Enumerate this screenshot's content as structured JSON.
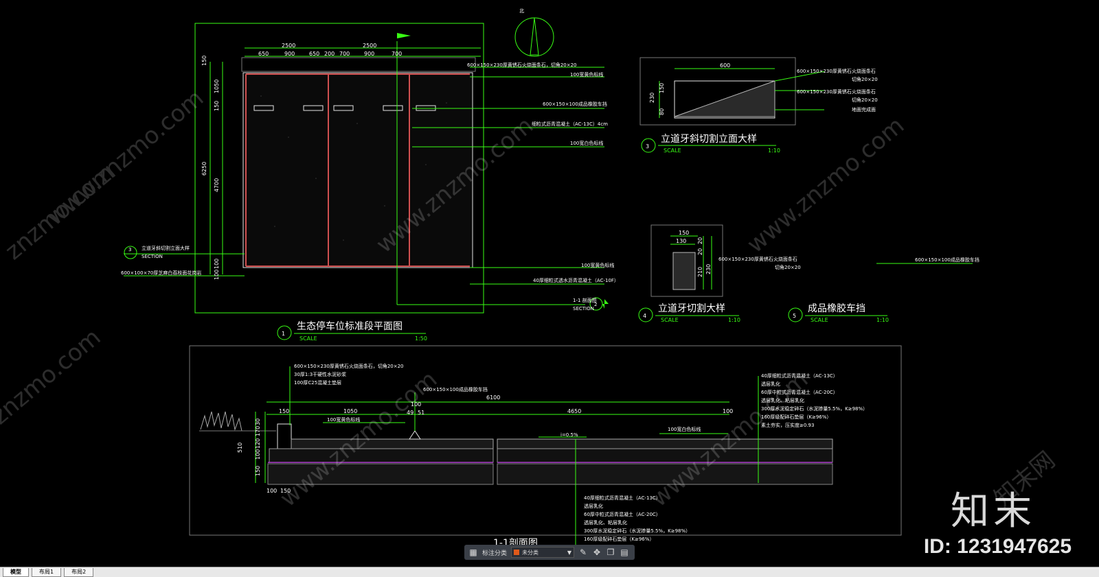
{
  "drawings": {
    "plan": {
      "number": "1",
      "title": "生态停车位标准段平面图",
      "scale_label": "SCALE",
      "scale_value": "1:50",
      "dims_top": [
        "2500",
        "2500"
      ],
      "dims_top_sub": [
        "650",
        "900",
        "650",
        "200",
        "700",
        "900",
        "700"
      ],
      "dims_left": [
        "150",
        "1050",
        "150",
        "6250",
        "4700",
        "100",
        "100"
      ],
      "leaders": [
        "600×150×230厚黄锈石火烧面条石，切角20×20",
        "100宽黄色标线",
        "600×150×100成品橡胶车挡",
        "细粒式沥青混凝土（AC-13C）4cm",
        "100宽白色标线",
        "100宽黄色标线",
        "40厚细粒式透水沥青混凝土（AC-10F）"
      ],
      "left_note_1": "立道牙斜切割立面大样",
      "left_note_1_sub": "SECTION",
      "left_note_1_num": "3",
      "left_note_2": "600×100×70厚芝麻白荔枝面花岗岩",
      "section_mark_num": "2",
      "section_mark_label": "1-1 剖面图",
      "section_mark_sub": "SECTION"
    },
    "detail3": {
      "number": "3",
      "title": "立道牙斜切割立面大样",
      "scale_label": "SCALE",
      "scale_value": "1:10",
      "dim_top": "600",
      "dims_left": [
        "230",
        "150",
        "80"
      ],
      "leaders": [
        "600×150×230厚黄锈石火烧面条石",
        "切角20×20",
        "600×150×230厚黄锈石火烧面条石",
        "切角20×20",
        "地面完成面"
      ]
    },
    "detail4": {
      "number": "4",
      "title": "立道牙切割大样",
      "scale_label": "SCALE",
      "scale_value": "1:10",
      "dims_top": [
        "150",
        "130"
      ],
      "dims_right": [
        "20",
        "20",
        "210",
        "230"
      ],
      "leaders": [
        "600×150×230厚黄锈石火烧面条石",
        "切角20×20"
      ]
    },
    "detail5": {
      "number": "5",
      "title": "成品橡胶车挡",
      "scale_label": "SCALE",
      "scale_value": "1:10",
      "leader": "600×150×100成品橡胶车挡"
    },
    "section": {
      "title": "1-1剖面图",
      "dims_top": [
        "6100",
        "100",
        "150",
        "1050",
        "4650",
        "100",
        "49",
        "51",
        "50"
      ],
      "dims_left": [
        "510",
        "150",
        "100",
        "120",
        "170",
        "30"
      ],
      "dims_bottom": [
        "100",
        "150"
      ],
      "slope": "i=0.5%",
      "bumper_leader": "600×150×100成品橡胶车挡",
      "yellow_line": "100宽黄色标线",
      "white_line": "100宽白色标线",
      "left_leaders": [
        "600×150×230厚黄锈石火烧面条石，切角20×20",
        "30厚1:3干硬性水泥砂浆",
        "100厚C25混凝土垫层"
      ],
      "right_leaders": [
        "40厚细粒式沥青混凝土（AC-13C）",
        "透层乳化",
        "60厚中粒式沥青混凝土（AC-20C）",
        "透层乳化、粘层乳化",
        "300厚水泥稳定碎石（水泥掺量5.5%，K≥98%）",
        "160厚级配碎石垫层（K≥96%）",
        "素土夯实，压实度≥0.93"
      ],
      "bottom_leaders": [
        "40厚细粒式沥青混凝土（AC-13C）",
        "透层乳化",
        "60厚中粒式沥青混凝土（AC-20C）",
        "透层乳化、粘层乳化",
        "300厚水泥稳定碎石（水泥掺量5.5%，K≥98%）",
        "160厚级配碎石垫层（K≥96%）"
      ]
    },
    "north_label": "北"
  },
  "watermark": {
    "site": "znzmo.com",
    "site_full": "www.znzmo.com",
    "brand_cn": "知末网",
    "logo_text": "知末",
    "id_text": "ID: 1231947625"
  },
  "toolbar": {
    "label": "标注分类",
    "select_value": "未分类",
    "swatch_color": "#e05a1a"
  },
  "tabs": [
    "模型",
    "布局1",
    "布局2"
  ]
}
